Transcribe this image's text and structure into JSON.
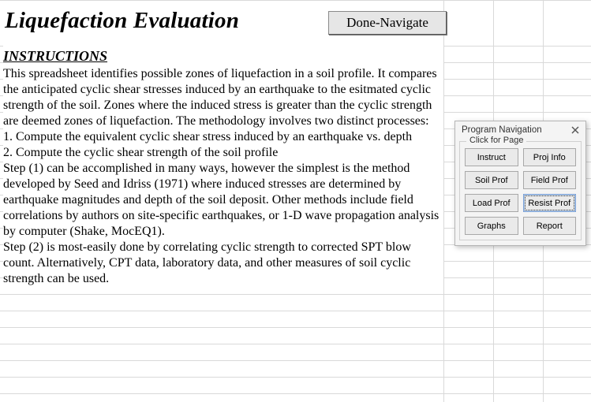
{
  "title": "Liquefaction Evaluation",
  "done_button": "Done-Navigate",
  "instructions_header": "INSTRUCTIONS",
  "body": {
    "intro": "This spreadsheet identifies possible zones of liquefaction in a soil profile. It compares the anticipated cyclic shear stresses induced by an earthquake to the esitmated cyclic strength of the soil. Zones where the induced stress is greater than the cyclic strength are deemed zones of liquefaction. The methodology involves two distinct processes:",
    "step1": "1. Compute the equivalent cyclic shear stress induced by an earthquake vs. depth",
    "step2": "2. Compute the cyclic shear strength of the soil profile",
    "para2": "Step (1) can be accomplished in many ways, however the simplest is the method developed by Seed and Idriss (1971) where induced stresses are determined by earthquake magnitudes and depth of the soil deposit. Other methods include field correlations by authors on site-specific earthquakes, or 1-D wave propagation analysis by computer (Shake, MocEQ1).",
    "para3": "Step (2) is most-easily done by correlating cyclic strength to corrected SPT blow count. Alternatively, CPT data, laboratory data, and other measures of soil cyclic strength can be used."
  },
  "nav_panel": {
    "title": "Program Navigation",
    "group_legend": "Click for Page",
    "buttons": {
      "instruct": "Instruct",
      "proj_info": "Proj Info",
      "soil_prof": "Soil Prof",
      "field_prof": "Field Prof",
      "load_prof": "Load Prof",
      "resist_prof": "Resist Prof",
      "graphs": "Graphs",
      "report": "Report"
    }
  }
}
